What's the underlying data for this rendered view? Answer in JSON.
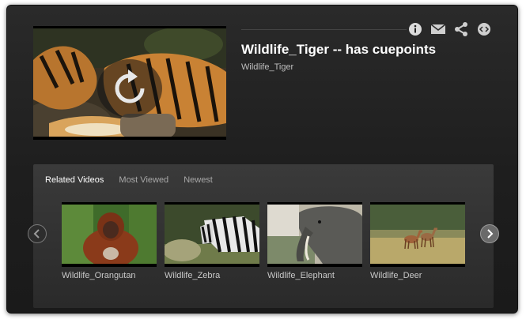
{
  "player": {
    "title": "Wildlife_Tiger -- has cuepoints",
    "subtitle": "Wildlife_Tiger",
    "replay_icon": "replay-icon"
  },
  "toolbar": {
    "icons": [
      "info-icon",
      "email-icon",
      "share-icon",
      "embed-icon"
    ]
  },
  "related": {
    "tabs": [
      {
        "label": "Related Videos",
        "active": true
      },
      {
        "label": "Most Viewed",
        "active": false
      },
      {
        "label": "Newest",
        "active": false
      }
    ],
    "videos": [
      {
        "label": "Wildlife_Orangutan"
      },
      {
        "label": "Wildlife_Zebra"
      },
      {
        "label": "Wildlife_Elephant"
      },
      {
        "label": "Wildlife_Deer"
      }
    ],
    "prev_icon": "chevron-left-icon",
    "next_icon": "chevron-right-icon"
  }
}
